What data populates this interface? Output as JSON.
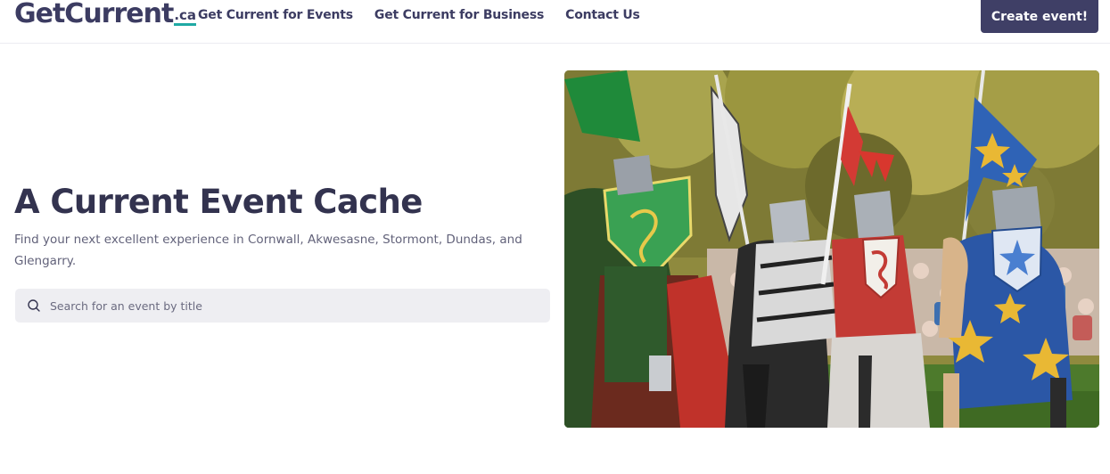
{
  "header": {
    "logo": {
      "main": "GetCurrent",
      "tld": ".ca"
    },
    "nav": [
      {
        "label": "Get Current for Events"
      },
      {
        "label": "Get Current for Business"
      },
      {
        "label": "Contact Us"
      }
    ],
    "cta_label": "Create event!"
  },
  "hero": {
    "title": "A Current Event Cache",
    "subtitle": "Find your next excellent experience in Cornwall, Akwesasne, Stormont, Dundas, and Glengarry.",
    "search": {
      "placeholder": "Search for an event by title",
      "value": "",
      "icon": "search-icon"
    },
    "image": {
      "subject": "jousting-knights-photo"
    }
  },
  "colors": {
    "brand": "#3f3f66",
    "accent": "#1fa9a4",
    "search_bg": "#eeeef2"
  }
}
